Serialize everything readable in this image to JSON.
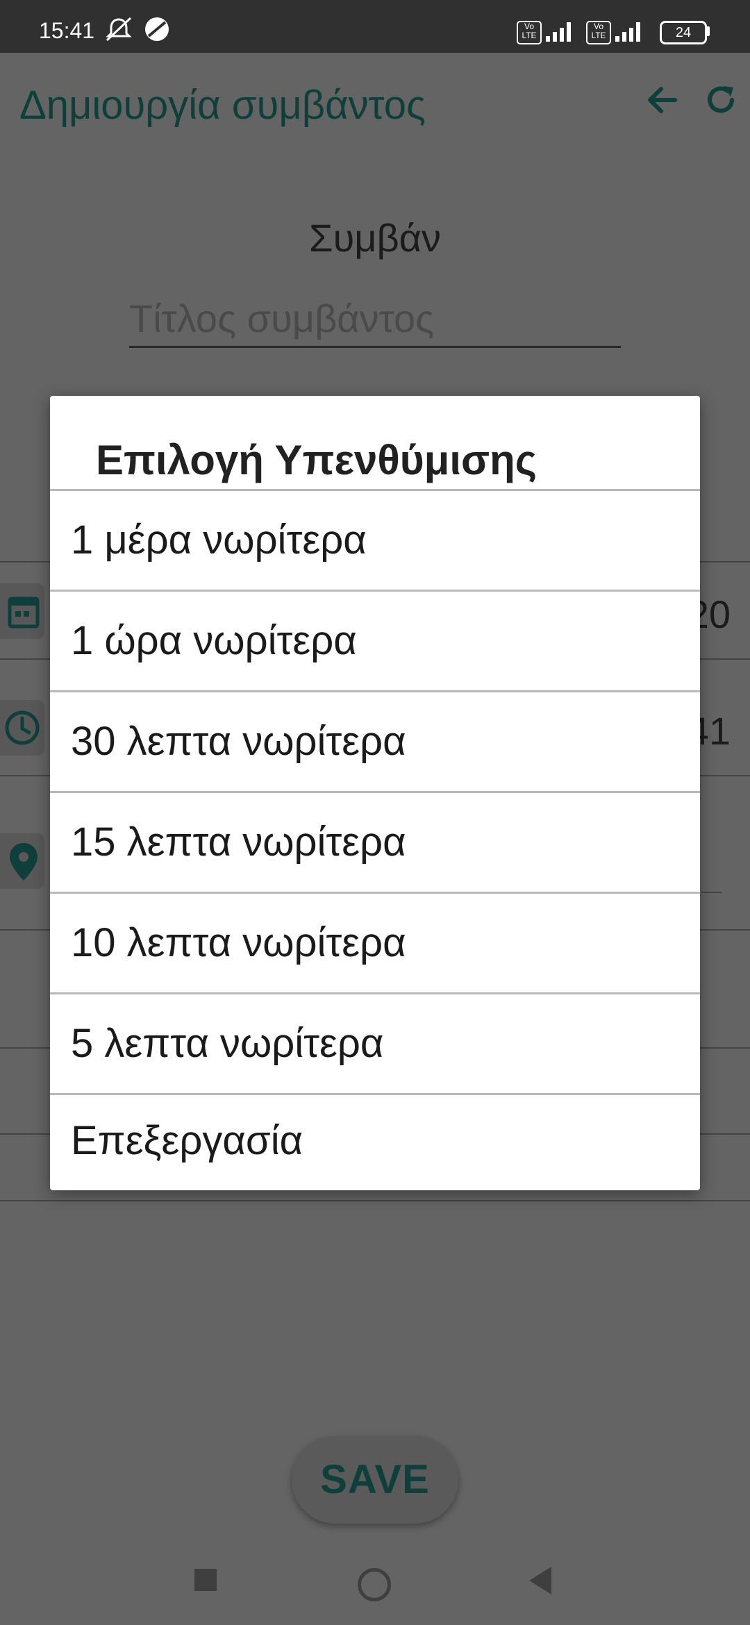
{
  "status_bar": {
    "time": "15:41",
    "battery": "24",
    "lte1": "Vo LTE",
    "lte2": "Vo LTE"
  },
  "app_bar": {
    "title": "Δημιουργία συμβάντος",
    "icons": [
      "back-arrow-icon",
      "refresh-icon"
    ]
  },
  "form": {
    "section_title": "Συμβάν",
    "title_placeholder": "Τίτλος συμβάντος",
    "date_partial": "20",
    "time_partial": "41"
  },
  "dialog": {
    "title": "Επιλογή Υπενθύμισης",
    "options": [
      "1 μέρα νωρίτερα",
      "1 ώρα νωρίτερα",
      "30 λεπτα νωρίτερα",
      "15 λεπτα νωρίτερα",
      "10 λεπτα νωρίτερα",
      "5 λεπτα νωρίτερα",
      "Επεξεργασία"
    ]
  },
  "save_button": {
    "label": "SAVE"
  },
  "colors": {
    "accent": "#0e3f3a",
    "scrim_background": "#646464",
    "status_bar": "#303030",
    "dialog_background": "#ffffff"
  }
}
